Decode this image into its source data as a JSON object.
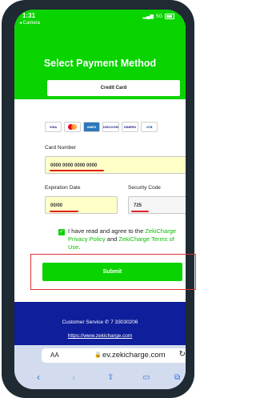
{
  "status_bar": {
    "time": "1:31",
    "back_label": "◂ Camera",
    "network": "5G"
  },
  "header": {
    "title": "Select Payment Method",
    "credit_card_label": "Credit Card"
  },
  "card_logos": [
    "VISA",
    "MC",
    "AMEX",
    "DISCOVER",
    "DINERS",
    "JCB"
  ],
  "form": {
    "card_number_label": "Card Number",
    "card_number_value": "0000 0000 0000 0000",
    "expiration_label": "Expiration Date",
    "expiration_value": "00/00",
    "security_label": "Security Code",
    "security_value": "725"
  },
  "agreement": {
    "prefix": "I have read and agree to the ",
    "privacy_link": "ZekiCharge Privacy Policy",
    "and": " and ",
    "terms_link": "ZekiCharge Terms of Use",
    "suffix": "."
  },
  "submit_label": "Submit",
  "footer": {
    "customer_service": "Customer Service",
    "phone": "7 33030206",
    "website": "https://www.zekicharge.com"
  },
  "browser": {
    "aa_label": "AA",
    "url": "ev.zekicharge.com"
  },
  "colors": {
    "brand_green": "#09d400",
    "footer_blue": "#0f1e9a",
    "highlight_red": "#e02020"
  }
}
